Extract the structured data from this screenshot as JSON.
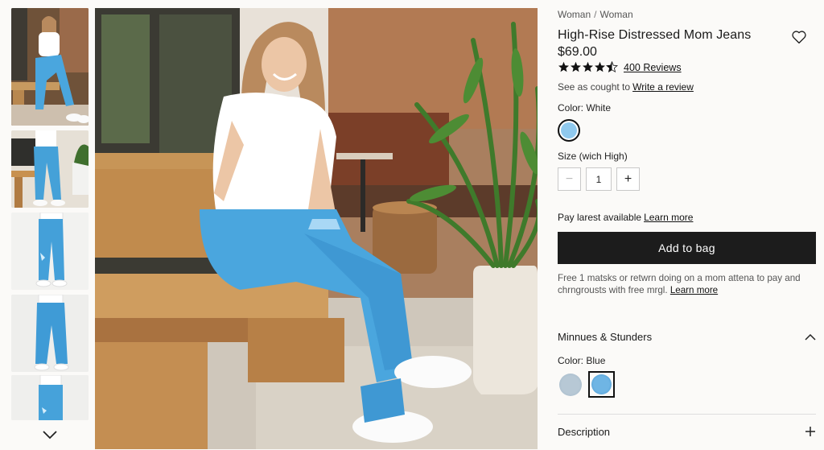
{
  "breadcrumb": {
    "parent": "Woman",
    "separator": "/",
    "current": "Woman"
  },
  "product": {
    "title": "High-Rise Distressed Mom Jeans",
    "price": "$69.00",
    "rating": 4.5,
    "reviews_label": "400 Reviews"
  },
  "seen": {
    "text": "See as cought to",
    "link": "Write a review"
  },
  "color": {
    "label": "Color: White"
  },
  "size": {
    "label": "Size (wich High)",
    "quantity": "1",
    "minus": "−",
    "plus": "+"
  },
  "paylater": {
    "text": "Pay larest available",
    "link": "Learn more"
  },
  "add_to_bag": "Add to bag",
  "shipping": {
    "text": "Free 1 matsks or retwrn doing on a mom attena to pay and chrngrousts with free mrgl.",
    "link": "Learn more"
  },
  "section1": {
    "title": "Minnues & Stunders",
    "color_label": "Color: Blue"
  },
  "section2": {
    "title": "Description"
  },
  "colors": {
    "accent": "#1c1c1c",
    "denim": "#4aa6de",
    "background": "#fbfaf8"
  },
  "icons": {
    "wishlist": "heart-icon",
    "expand": "chevron-up-icon",
    "collapse": "plus-icon",
    "more_thumbs": "chevron-down-icon",
    "star": "star-icon"
  }
}
